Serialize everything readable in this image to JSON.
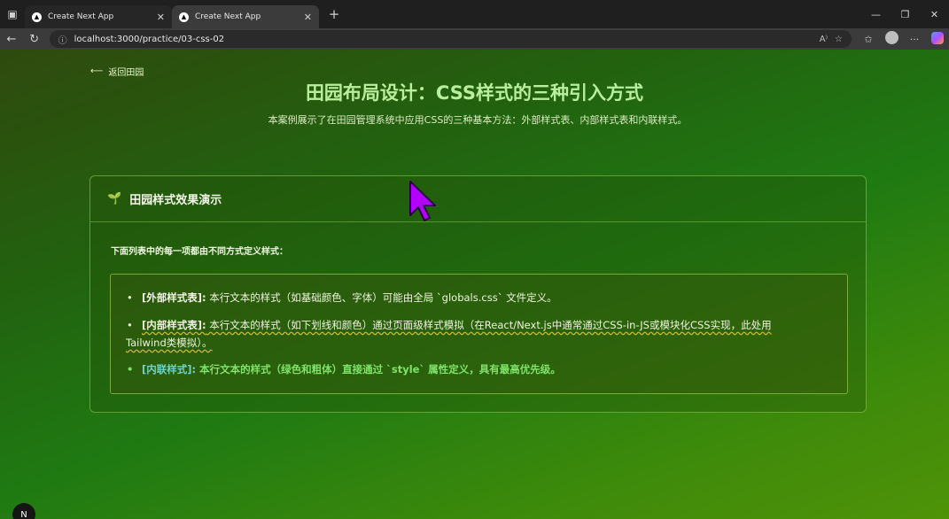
{
  "browser": {
    "tabs": [
      {
        "title": "Create Next App",
        "active": false
      },
      {
        "title": "Create Next App",
        "active": true
      }
    ],
    "url": "localhost:3000/practice/03-css-02"
  },
  "page": {
    "back_label": "返回田园",
    "title": "田园布局设计：CSS样式的三种引入方式",
    "subtitle": "本案例展示了在田园管理系统中应用CSS的三种基本方法：外部样式表、内部样式表和内联样式。",
    "card": {
      "icon": "sprout-icon",
      "title": "田园样式效果演示",
      "intro": "下面列表中的每一项都由不同方式定义样式：",
      "items": [
        {
          "tag": "[外部样式表]:",
          "text": " 本行文本的样式（如基础颜色、字体）可能由全局 `globals.css` 文件定义。"
        },
        {
          "tag": "[内部样式表]:",
          "text_line1": " 本行文本的样式（如下划线和颜色）通过页面级样式模拟（在React/Next.js中通常通过CSS-in-JS或模块化CSS实现，此处用",
          "text_line2": "Tailwind类模拟）。"
        },
        {
          "tag": "[内联样式]:",
          "text": " 本行文本的样式（绿色和粗体）直接通过 `style` 属性定义，具有最高优先级。"
        }
      ]
    }
  },
  "colors": {
    "title": "#b9ef9c",
    "inline_item": "#7fe36a",
    "cursor": "#b300ff"
  }
}
